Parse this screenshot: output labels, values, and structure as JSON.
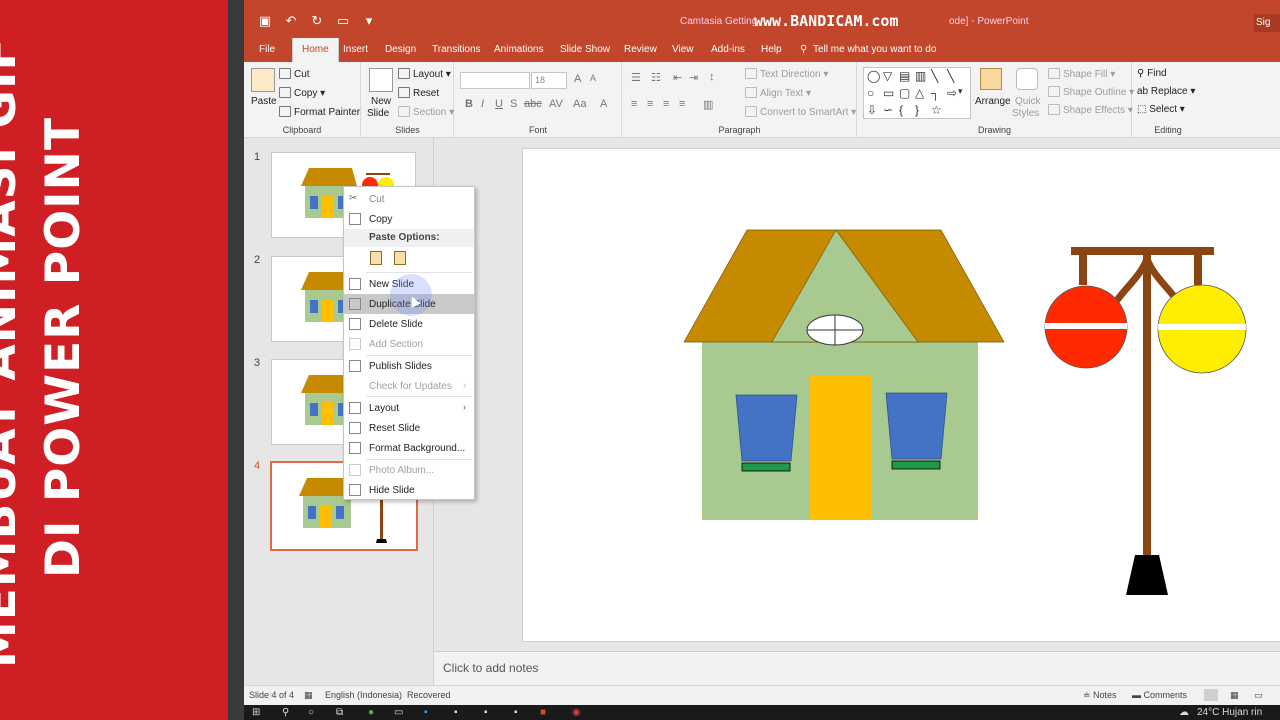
{
  "banner": {
    "line1": "MEMBUAT ANIMASI GIF",
    "line2": "DI POWER POINT"
  },
  "window": {
    "title_left": "Camtasia Getting",
    "watermark": "www.BANDICAM.com",
    "title_right": "ode]  -  PowerPoint",
    "sign_in": "Sig"
  },
  "tabs": [
    "File",
    "Home",
    "Insert",
    "Design",
    "Transitions",
    "Animations",
    "Slide Show",
    "Review",
    "View",
    "Add-ins",
    "Help"
  ],
  "tell_me": "Tell me what you want to do",
  "ribbon": {
    "clipboard": {
      "paste": "Paste",
      "cut": "Cut",
      "copy": "Copy",
      "format_painter": "Format Painter",
      "label": "Clipboard"
    },
    "slides": {
      "new_slide": "New",
      "new_slide2": "Slide",
      "layout": "Layout",
      "reset": "Reset",
      "section": "Section",
      "label": "Slides"
    },
    "font": {
      "size": "18",
      "label": "Font"
    },
    "paragraph": {
      "text_direction": "Text Direction",
      "align_text": "Align Text",
      "smartart": "Convert to SmartArt",
      "label": "Paragraph"
    },
    "drawing": {
      "arrange": "Arrange",
      "quick_styles": "Quick",
      "quick_styles2": "Styles",
      "shape_fill": "Shape Fill",
      "shape_outline": "Shape Outline",
      "shape_effects": "Shape Effects",
      "label": "Drawing"
    },
    "editing": {
      "find": "Find",
      "replace": "Replace",
      "select": "Select",
      "label": "Editing"
    }
  },
  "slides": [
    "1",
    "2",
    "3",
    "4"
  ],
  "context_menu": {
    "cut": "Cut",
    "copy": "Copy",
    "paste_options": "Paste Options:",
    "new_slide": "New Slide",
    "duplicate_slide": "Duplicate Slide",
    "delete_slide": "Delete Slide",
    "add_section": "Add Section",
    "publish_slides": "Publish Slides",
    "check_updates": "Check for Updates",
    "layout": "Layout",
    "reset_slide": "Reset Slide",
    "format_background": "Format Background...",
    "photo_album": "Photo Album...",
    "hide_slide": "Hide Slide"
  },
  "notes_placeholder": "Click to add notes",
  "status": {
    "slide_info": "Slide 4 of 4",
    "language": "English (Indonesia)",
    "recovered": "Recovered",
    "notes": "Notes",
    "comments": "Comments"
  },
  "taskbar": {
    "weather": "24°C  Hujan rin"
  },
  "colors": {
    "banner_red": "#cf1f25",
    "ppt_orange": "#c1462b",
    "roof": "#c68a00",
    "wall": "#a8c98f",
    "door": "#ffbf00",
    "window_blue": "#4472c4",
    "sill_green": "#1e9a4a",
    "pole_brown": "#8b4513",
    "lamp_red": "#ff2a00",
    "lamp_yellow": "#ffee00"
  }
}
